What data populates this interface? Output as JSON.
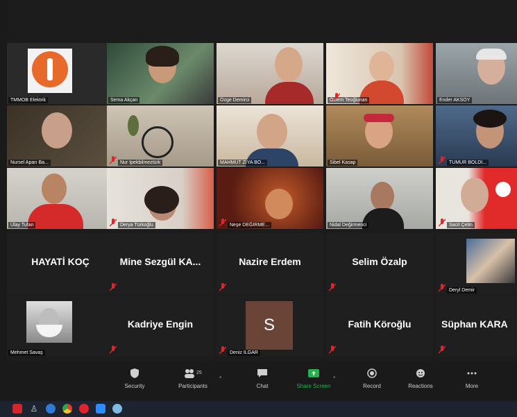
{
  "colors": {
    "background": "#1c1c1c",
    "tile": "#1f1f1f",
    "share_green": "#22b24c",
    "mute_red": "#e0252a",
    "avatar_brown": "#6b4438"
  },
  "participants": [
    {
      "name": "TMMOB Elektrik"
    },
    {
      "name": "Sema Akçan"
    },
    {
      "name": "Özge Demirci"
    },
    {
      "name": "Özlem Teoğlunan"
    },
    {
      "name": "Ender AKSOY"
    },
    {
      "name": "Nursel Aparı Ba..."
    },
    {
      "name": "Nur İpekbilmeztürk"
    },
    {
      "name": "MAHMUT ZİYA BÖ..."
    },
    {
      "name": "Sibel Kasap"
    },
    {
      "name": "TUMUR BOLDİ..."
    },
    {
      "name": "Ülay Tufan"
    },
    {
      "name": "Derya Türkoğlu"
    },
    {
      "name": "Neşe DEĞİRME..."
    },
    {
      "name": "Nidal Değirmenci"
    },
    {
      "name": "Sacit Çetin"
    },
    {
      "name": "HAYATİ KOÇ"
    },
    {
      "name": "Mine Sezgül KA..."
    },
    {
      "name": "Nazire Erdem"
    },
    {
      "name": "Selim Özalp"
    },
    {
      "name": "Deryl Demir"
    },
    {
      "name": "Mehmet Savaş"
    },
    {
      "name": "Kadriye Engin"
    },
    {
      "name": "Deniz İLGAR",
      "initial": "S"
    },
    {
      "name": "Fatih Köroğlu"
    },
    {
      "name": "Süphan KARA"
    }
  ],
  "toolbar": {
    "security": "Security",
    "participants": "Participants",
    "participants_count": "25",
    "chat": "Chat",
    "share_screen": "Share Screen",
    "record": "Record",
    "reactions": "Reactions",
    "more": "More"
  },
  "taskbar_icons": [
    "acrobat-icon",
    "pin-icon",
    "edge-icon",
    "chrome-icon",
    "opera-icon",
    "zoom-icon",
    "paint-icon"
  ]
}
